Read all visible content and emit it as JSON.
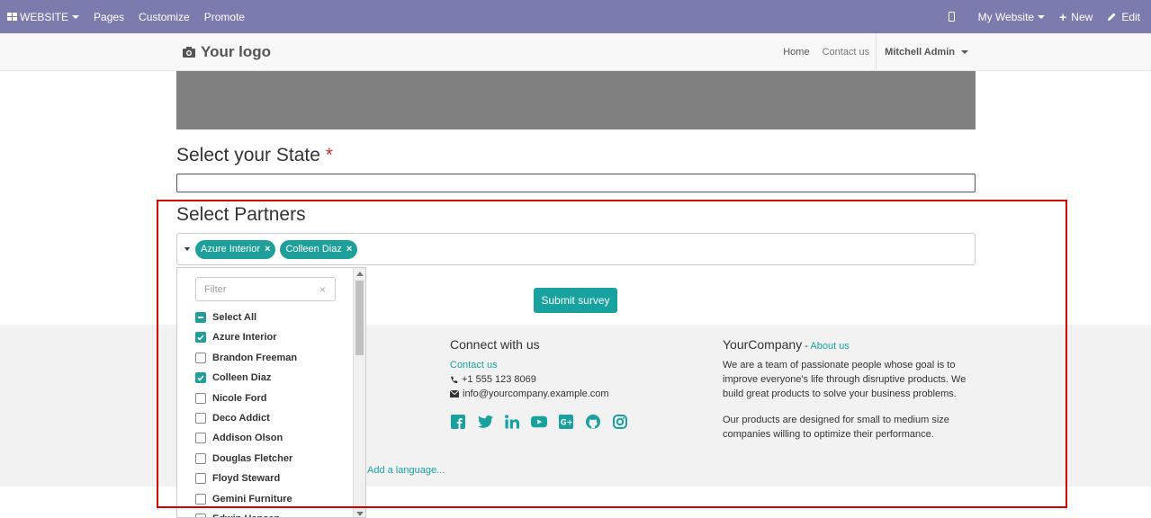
{
  "adminbar": {
    "website_label": "WEBSITE",
    "pages": "Pages",
    "customize": "Customize",
    "promote": "Promote",
    "my_website": "My Website",
    "new": "New",
    "edit": "Edit"
  },
  "header": {
    "logo": "Your logo",
    "nav": [
      "Home",
      "Contact us"
    ],
    "user": "Mitchell Admin"
  },
  "form": {
    "state_title": "Select your State",
    "required_mark": "*",
    "partners_title": "Select Partners",
    "selected_tags": [
      "Azure Interior",
      "Colleen Diaz"
    ],
    "tag_remove": "×",
    "submit": "Submit survey"
  },
  "dropdown": {
    "filter_placeholder": "Filter",
    "filter_clear": "×",
    "options": [
      {
        "label": "Select All",
        "state": "partial"
      },
      {
        "label": "Azure Interior",
        "state": "checked"
      },
      {
        "label": "Brandon Freeman",
        "state": "unchecked"
      },
      {
        "label": "Colleen Diaz",
        "state": "checked"
      },
      {
        "label": "Nicole Ford",
        "state": "unchecked"
      },
      {
        "label": "Deco Addict",
        "state": "unchecked"
      },
      {
        "label": "Addison Olson",
        "state": "unchecked"
      },
      {
        "label": "Douglas Fletcher",
        "state": "unchecked"
      },
      {
        "label": "Floyd Steward",
        "state": "unchecked"
      },
      {
        "label": "Gemini Furniture",
        "state": "unchecked"
      },
      {
        "label": "Edwin Hansen",
        "state": "unchecked"
      }
    ]
  },
  "footer": {
    "connect_title": "Connect with us",
    "contact_link": "Contact us",
    "phone": "+1 555 123 8069",
    "email": "info@yourcompany.example.com",
    "social_icons": [
      "facebook-icon",
      "twitter-icon",
      "linkedin-icon",
      "youtube-icon",
      "google-plus-icon",
      "github-icon",
      "instagram-icon"
    ],
    "company_name": "YourCompany",
    "company_sep": " - ",
    "about_link": "About us",
    "about_p1": "We are a team of passionate people whose goal is to improve everyone's life through disruptive products. We build great products to solve your business problems.",
    "about_p2": "Our products are designed for small to medium size companies willing to optimize their performance.",
    "add_language": "Add a language..."
  },
  "colors": {
    "adminbar": "#7c7bad",
    "accent": "#17a2a0",
    "annotation": "#d40000"
  }
}
